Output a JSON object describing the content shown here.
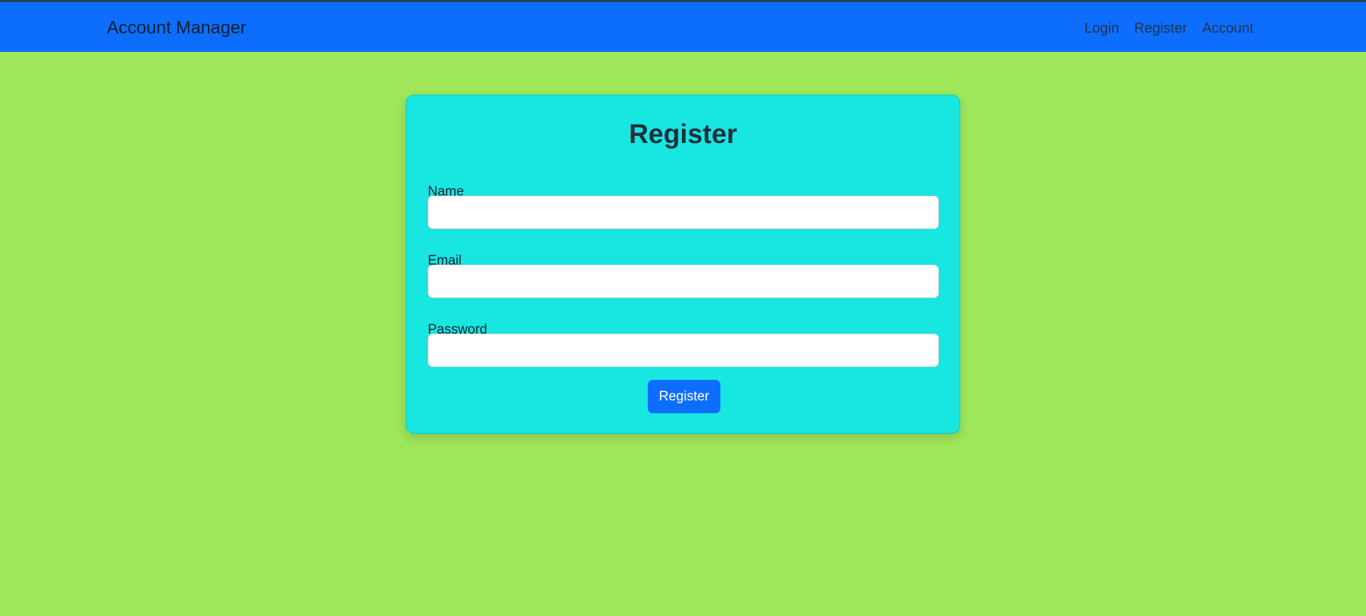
{
  "navbar": {
    "brand": "Account Manager",
    "links": [
      {
        "label": "Login"
      },
      {
        "label": "Register"
      },
      {
        "label": "Account"
      }
    ],
    "color": "#0d6efd"
  },
  "page": {
    "background_color": "#a0e75a"
  },
  "form": {
    "title": "Register",
    "card_color": "#18e6e1",
    "fields": [
      {
        "label": "Name",
        "value": "",
        "placeholder": ""
      },
      {
        "label": "Email",
        "value": "",
        "placeholder": ""
      },
      {
        "label": "Password",
        "value": "",
        "placeholder": ""
      }
    ],
    "submit_label": "Register",
    "submit_color": "#0d6efd"
  }
}
